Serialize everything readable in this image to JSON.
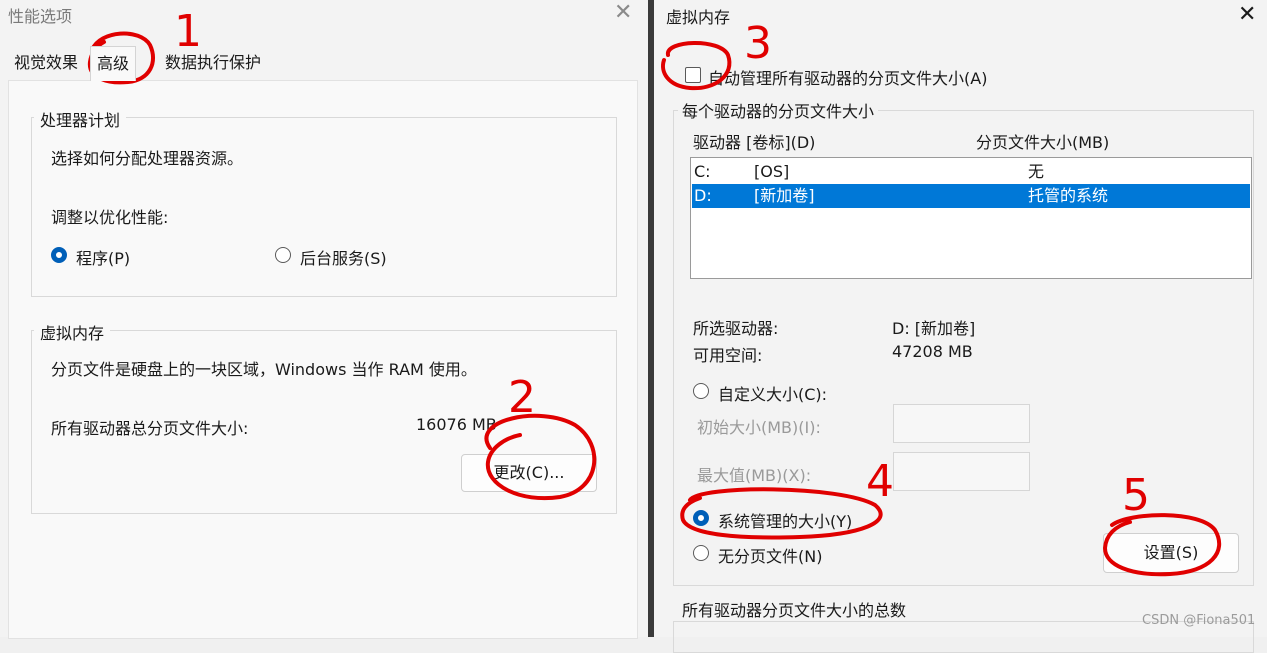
{
  "left_window": {
    "title": "性能选项",
    "tabs": [
      "视觉效果",
      "高级",
      "数据执行保护"
    ],
    "processor_group": {
      "title": "处理器计划",
      "description": "选择如何分配处理器资源。",
      "adjust_label": "调整以优化性能:",
      "option_programs": "程序(P)",
      "option_background": "后台服务(S)"
    },
    "vm_group": {
      "title": "虚拟内存",
      "description": "分页文件是硬盘上的一块区域，Windows 当作 RAM 使用。",
      "total_label": "所有驱动器总分页文件大小:",
      "total_value": "16076 MB",
      "change_button": "更改(C)..."
    }
  },
  "right_window": {
    "title": "虚拟内存",
    "auto_manage_label": "自动管理所有驱动器的分页文件大小(A)",
    "auto_manage_checked": false,
    "per_drive_group": {
      "title": "每个驱动器的分页文件大小",
      "col_drive": "驱动器 [卷标](D)",
      "col_size": "分页文件大小(MB)",
      "rows": [
        {
          "drive": "C:",
          "label": "[OS]",
          "size": "无"
        },
        {
          "drive": "D:",
          "label": "[新加卷]",
          "size": "托管的系统"
        }
      ],
      "selected_drive_label": "所选驱动器:",
      "selected_drive_value": "D:  [新加卷]",
      "free_space_label": "可用空间:",
      "free_space_value": "47208 MB",
      "custom_size": "自定义大小(C):",
      "initial_size": "初始大小(MB)(I):",
      "max_size": "最大值(MB)(X):",
      "system_managed": "系统管理的大小(Y)",
      "no_paging": "无分页文件(N)",
      "set_button": "设置(S)"
    },
    "total_group_title": "所有驱动器分页文件大小的总数"
  },
  "annotations": {
    "color": "#e00000",
    "labels": [
      "1",
      "2",
      "3",
      "4",
      "5"
    ]
  },
  "watermark": "CSDN @Fiona501"
}
